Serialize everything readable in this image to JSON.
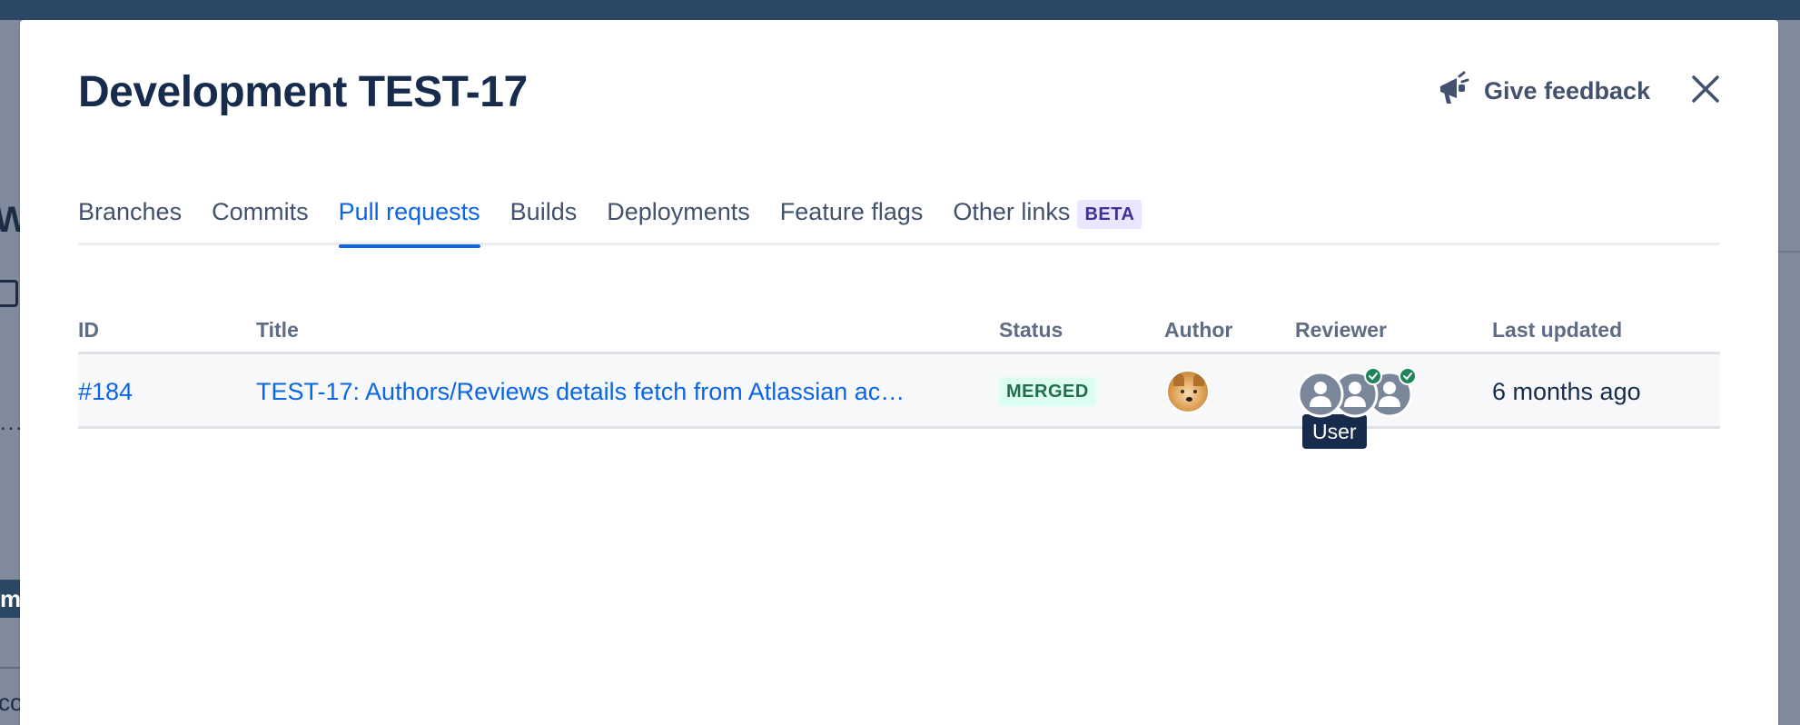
{
  "backdrop": {
    "letter_w": "W",
    "letter_m": "m",
    "text_co": "co",
    "dots": "......"
  },
  "modal": {
    "title": "Development TEST-17",
    "feedback_label": "Give feedback",
    "feedback_icon": "megaphone-icon",
    "close_icon": "close-icon"
  },
  "tabs": [
    {
      "label": "Branches",
      "active": false
    },
    {
      "label": "Commits",
      "active": false
    },
    {
      "label": "Pull requests",
      "active": true
    },
    {
      "label": "Builds",
      "active": false
    },
    {
      "label": "Deployments",
      "active": false
    },
    {
      "label": "Feature flags",
      "active": false
    },
    {
      "label": "Other links",
      "active": false,
      "badge": "BETA"
    }
  ],
  "table": {
    "headers": {
      "id": "ID",
      "title": "Title",
      "status": "Status",
      "author": "Author",
      "reviewer": "Reviewer",
      "last_updated": "Last updated"
    },
    "rows": [
      {
        "id": "#184",
        "title": "TEST-17: Authors/Reviews details fetch from Atlassian ac…",
        "status": "MERGED",
        "author_avatar": "doge-avatar",
        "reviewers": [
          {
            "icon": "user-avatar-icon",
            "approved": false
          },
          {
            "icon": "user-avatar-icon",
            "approved": true
          },
          {
            "icon": "user-avatar-icon",
            "approved": true
          }
        ],
        "last_updated": "6 months ago"
      }
    ]
  },
  "tooltip": {
    "label": "User"
  },
  "colors": {
    "accent": "#0c66e4",
    "merged_bg": "#dcfff1",
    "merged_text": "#216e4e",
    "beta_bg": "#eae6ff",
    "beta_text": "#403294",
    "tooltip_bg": "#172b4d"
  }
}
